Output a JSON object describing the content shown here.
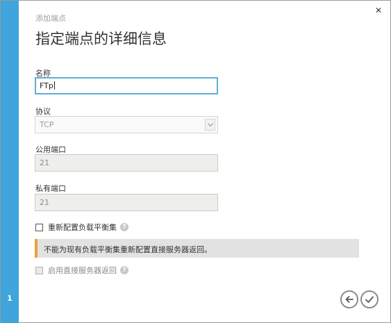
{
  "dialog": {
    "subtitle": "添加端点",
    "title": "指定端点的详细信息",
    "step": "1",
    "close_icon": "close-icon"
  },
  "form": {
    "name": {
      "label": "名称",
      "value": "FTp"
    },
    "protocol": {
      "label": "协议",
      "selected": "TCP"
    },
    "public_port": {
      "label": "公用端口",
      "value": "21"
    },
    "private_port": {
      "label": "私有端口",
      "value": "21"
    },
    "reconfigure_lb": {
      "label": "重新配置负载平衡集",
      "checked": false
    },
    "notice": "不能为现有负载平衡集重新配置直接服务器返回。",
    "direct_server_return": {
      "label": "启用直接服务器返回",
      "checked": false,
      "enabled": false
    }
  },
  "footer": {
    "back_icon": "arrow-left-icon",
    "confirm_icon": "checkmark-icon"
  },
  "colors": {
    "sidebar": "#3fa5dc",
    "focus_border": "#5faed8",
    "notice_accent": "#e8a43a"
  }
}
